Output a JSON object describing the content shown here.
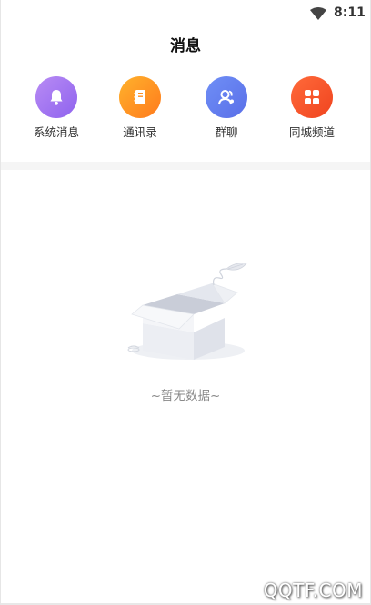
{
  "status_bar": {
    "time": "8:11",
    "wifi_icon": "wifi-icon"
  },
  "header": {
    "title": "消息"
  },
  "entries": [
    {
      "label": "系统消息",
      "icon": "bell-icon",
      "color_from": "#b88bf4",
      "color_to": "#8f63ee"
    },
    {
      "label": "通讯录",
      "icon": "address-book-icon",
      "color_from": "#ffb22c",
      "color_to": "#ff7a1c"
    },
    {
      "label": "群聊",
      "icon": "group-chat-icon",
      "color_from": "#6f8ff6",
      "color_to": "#5a6fe8"
    },
    {
      "label": "同城频道",
      "icon": "grid-icon",
      "color_from": "#ff6a3a",
      "color_to": "#f0441f"
    }
  ],
  "empty_state": {
    "text": "~暂无数据~",
    "icon": "empty-box-icon"
  },
  "watermark": "QQTF.COM"
}
